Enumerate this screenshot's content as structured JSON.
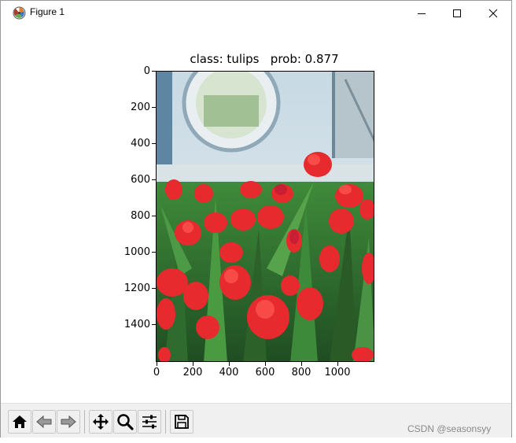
{
  "window": {
    "title": "Figure 1"
  },
  "plot": {
    "title": "class: tulips   prob: 0.877",
    "class_label": "tulips",
    "probability": 0.877,
    "y_ticks": [
      "0",
      "200",
      "400",
      "600",
      "800",
      "1000",
      "1200",
      "1400"
    ],
    "x_ticks": [
      "0",
      "200",
      "400",
      "600",
      "800",
      "1000"
    ],
    "image_description_icon": "tulip-photo"
  },
  "toolbar": {
    "buttons": [
      {
        "name": "home-icon"
      },
      {
        "name": "back-icon"
      },
      {
        "name": "forward-icon"
      },
      {
        "name": "pan-icon"
      },
      {
        "name": "zoom-icon"
      },
      {
        "name": "configure-subplots-icon"
      },
      {
        "name": "save-icon"
      }
    ]
  },
  "watermark": "CSDN @seasonsyy"
}
